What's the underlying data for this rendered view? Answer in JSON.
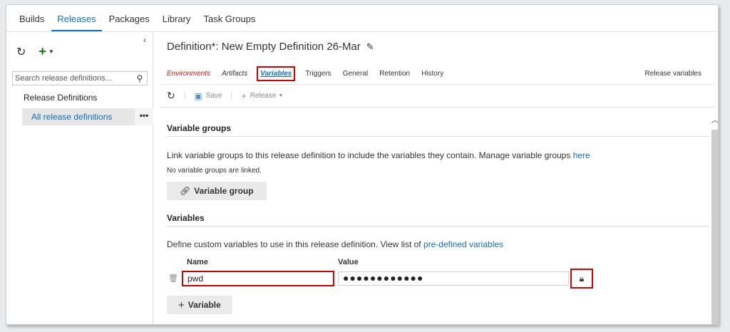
{
  "topnav": {
    "tabs": [
      "Builds",
      "Releases",
      "Packages",
      "Library",
      "Task Groups"
    ],
    "active": "Releases"
  },
  "left": {
    "search_placeholder": "Search release definitions...",
    "tree_root": "Release Definitions",
    "tree_item": "All release definitions",
    "more": "•••"
  },
  "definition": {
    "title": "Definition*: New Empty Definition 26-Mar"
  },
  "subtabs": {
    "environments": "Environments",
    "artifacts": "Artifacts",
    "variables": "Variables",
    "triggers": "Triggers",
    "general": "General",
    "retention": "Retention",
    "history": "History"
  },
  "release_variables_link": "Release variables",
  "toolbar": {
    "save": "Save",
    "release": "Release"
  },
  "variable_groups": {
    "heading": "Variable groups",
    "desc": "Link variable groups to this release definition to include the variables they contain. Manage variable groups ",
    "link": "here",
    "empty": "No variable groups are linked.",
    "button": "Variable group"
  },
  "variables": {
    "heading": "Variables",
    "desc": "Define custom variables to use in this release definition. View list of ",
    "link": "pre-defined variables",
    "col_name": "Name",
    "col_value": "Value",
    "row_name": "pwd",
    "row_value": "●●●●●●●●●●●●",
    "add_button": "Variable"
  },
  "colors": {
    "accent": "#106ebe",
    "highlight": "#d40000",
    "env_red": "#c41818"
  }
}
